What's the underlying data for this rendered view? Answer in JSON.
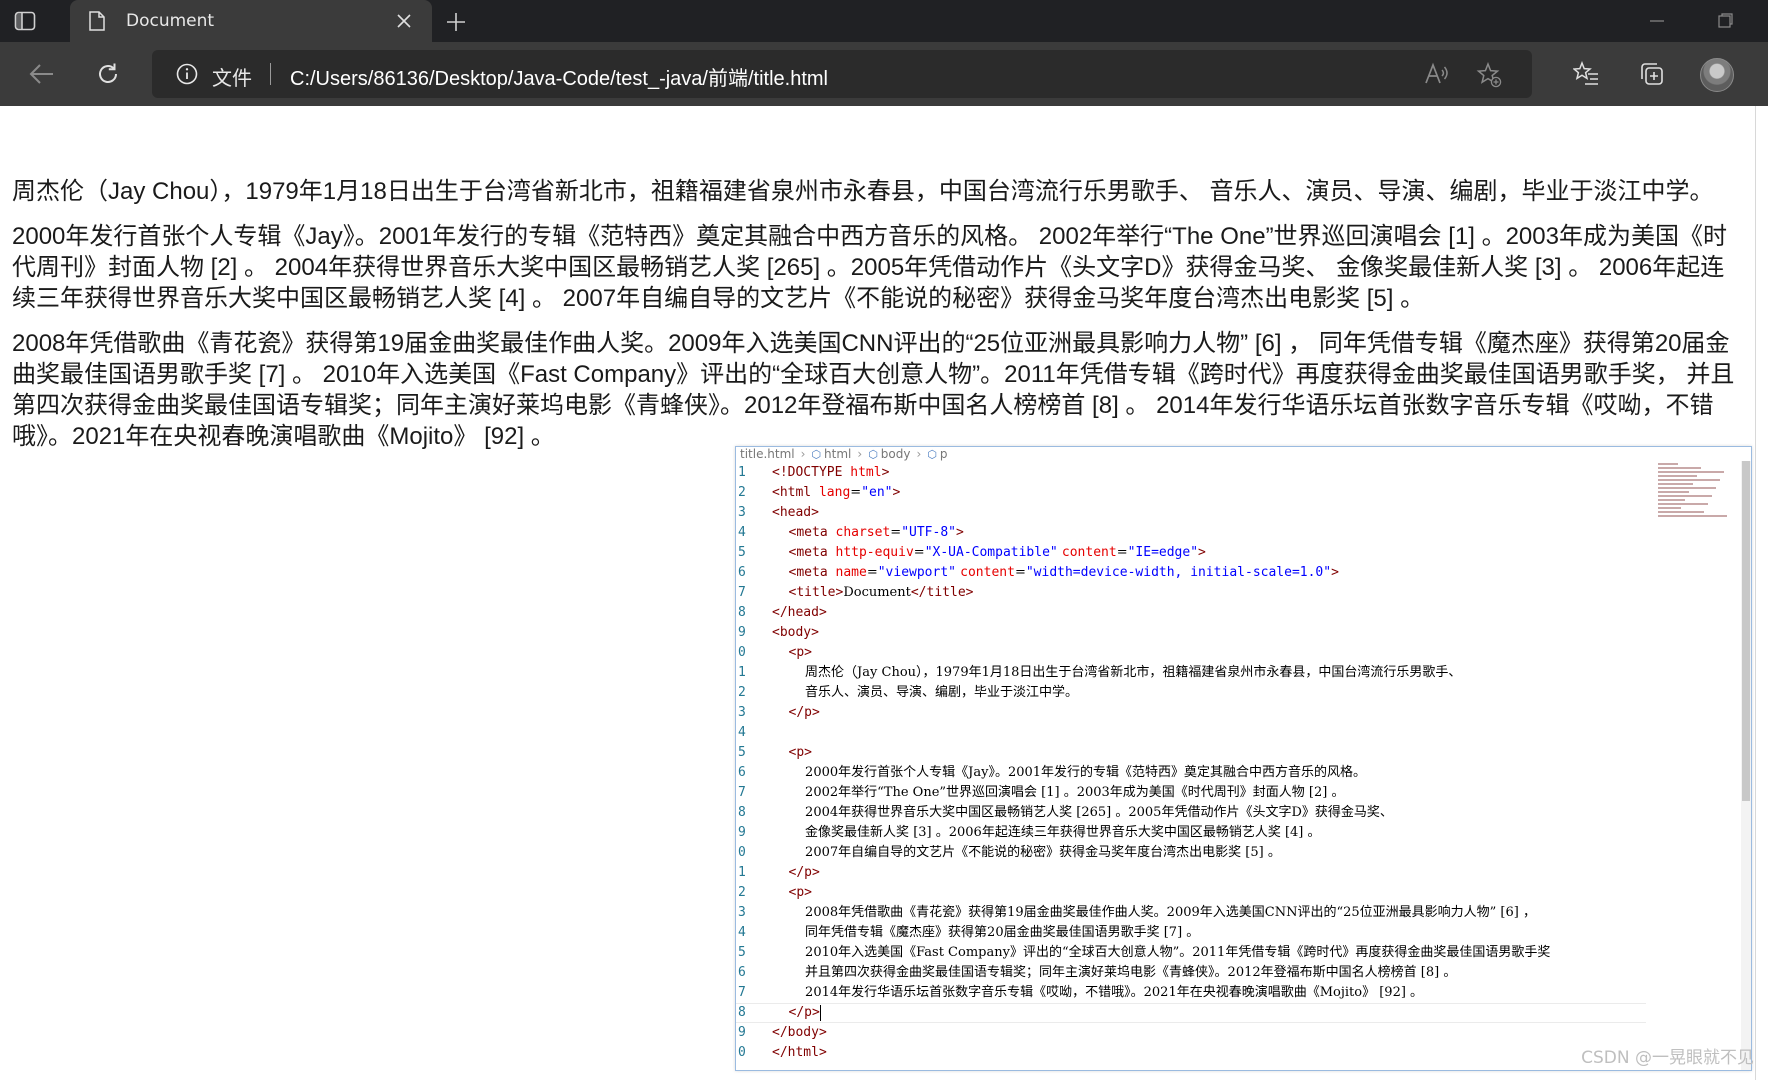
{
  "browser": {
    "tab": {
      "title": "Document",
      "icon": "page-icon"
    },
    "address": {
      "site_label": "文件",
      "url": "C:/Users/86136/Desktop/Java-Code/test_-java/前端/title.html"
    },
    "icons": [
      "sidebar-icon",
      "back-icon",
      "reload-icon",
      "info-icon",
      "read-aloud-icon",
      "add-favorite-icon",
      "favorites-icon",
      "collections-icon",
      "profile-avatar"
    ]
  },
  "page": {
    "paragraphs": [
      "周杰伦（Jay Chou），1979年1月18日出生于台湾省新北市，祖籍福建省泉州市永春县，中国台湾流行乐男歌手、 音乐人、演员、导演、编剧，毕业于淡江中学。",
      "2000年发行首张个人专辑《Jay》。2001年发行的专辑《范特西》奠定其融合中西方音乐的风格。 2002年举行“The One”世界巡回演唱会 [1] 。2003年成为美国《时代周刊》封面人物 [2] 。 2004年获得世界音乐大奖中国区最畅销艺人奖 [265] 。2005年凭借动作片《头文字D》获得金马奖、 金像奖最佳新人奖 [3] 。 2006年起连续三年获得世界音乐大奖中国区最畅销艺人奖 [4] 。 2007年自编自导的文艺片《不能说的秘密》获得金马奖年度台湾杰出电影奖 [5] 。",
      "2008年凭借歌曲《青花瓷》获得第19届金曲奖最佳作曲人奖。2009年入选美国CNN评出的“25位亚洲最具影响力人物” [6] ， 同年凭借专辑《魔杰座》获得第20届金曲奖最佳国语男歌手奖 [7] 。 2010年入选美国《Fast Company》评出的“全球百大创意人物”。2011年凭借专辑《跨时代》再度获得金曲奖最佳国语男歌手奖， 并且第四次获得金曲奖最佳国语专辑奖；同年主演好莱坞电影《青蜂侠》。2012年登福布斯中国名人榜榜首 [8] 。 2014年发行华语乐坛首张数字音乐专辑《哎呦，不错哦》。2021年在央视春晚演唱歌曲《Mojito》 [92] 。"
    ]
  },
  "editor": {
    "breadcrumb": [
      "title.html",
      "html",
      "body",
      "p"
    ],
    "lines": [
      {
        "n": "1",
        "segs": [
          [
            "tag",
            "<!DOCTYPE "
          ],
          [
            "attr",
            "html"
          ],
          [
            "tag",
            ">"
          ]
        ]
      },
      {
        "n": "2",
        "segs": [
          [
            "tag",
            "<html "
          ],
          [
            "attr",
            "lang"
          ],
          [
            "txt",
            "="
          ],
          [
            "str",
            "\"en\""
          ],
          [
            "tag",
            ">"
          ]
        ]
      },
      {
        "n": "3",
        "segs": [
          [
            "tag",
            "<head>"
          ]
        ]
      },
      {
        "n": "4",
        "segs": [
          [
            "txt",
            "    "
          ],
          [
            "tag",
            "<meta "
          ],
          [
            "attr",
            "charset"
          ],
          [
            "txt",
            "="
          ],
          [
            "str",
            "\"UTF-8\""
          ],
          [
            "tag",
            ">"
          ]
        ]
      },
      {
        "n": "5",
        "segs": [
          [
            "txt",
            "    "
          ],
          [
            "tag",
            "<meta "
          ],
          [
            "attr",
            "http-equiv"
          ],
          [
            "txt",
            "="
          ],
          [
            "str",
            "\"X-UA-Compatible\""
          ],
          [
            "txt",
            " "
          ],
          [
            "attr",
            "content"
          ],
          [
            "txt",
            "="
          ],
          [
            "str",
            "\"IE=edge\""
          ],
          [
            "tag",
            ">"
          ]
        ]
      },
      {
        "n": "6",
        "segs": [
          [
            "txt",
            "    "
          ],
          [
            "tag",
            "<meta "
          ],
          [
            "attr",
            "name"
          ],
          [
            "txt",
            "="
          ],
          [
            "str",
            "\"viewport\""
          ],
          [
            "txt",
            " "
          ],
          [
            "attr",
            "content"
          ],
          [
            "txt",
            "="
          ],
          [
            "str",
            "\"width=device-width, initial-scale=1.0\""
          ],
          [
            "tag",
            ">"
          ]
        ]
      },
      {
        "n": "7",
        "segs": [
          [
            "txt",
            "    "
          ],
          [
            "tag",
            "<title>"
          ],
          [
            "txt",
            "Document"
          ],
          [
            "tag",
            "</title>"
          ]
        ]
      },
      {
        "n": "8",
        "segs": [
          [
            "tag",
            "</head>"
          ]
        ]
      },
      {
        "n": "9",
        "segs": [
          [
            "tag",
            "<body>"
          ]
        ]
      },
      {
        "n": "0",
        "segs": [
          [
            "txt",
            "    "
          ],
          [
            "tag",
            "<p>"
          ]
        ]
      },
      {
        "n": "1",
        "segs": [
          [
            "txt",
            "        周杰伦（Jay Chou），1979年1月18日出生于台湾省新北市，祖籍福建省泉州市永春县，中国台湾流行乐男歌手、"
          ]
        ]
      },
      {
        "n": "2",
        "segs": [
          [
            "txt",
            "        音乐人、演员、导演、编剧，毕业于淡江中学。"
          ]
        ]
      },
      {
        "n": "3",
        "segs": [
          [
            "txt",
            "    "
          ],
          [
            "tag",
            "</p>"
          ]
        ]
      },
      {
        "n": "4",
        "segs": []
      },
      {
        "n": "5",
        "segs": [
          [
            "txt",
            "    "
          ],
          [
            "tag",
            "<p>"
          ]
        ]
      },
      {
        "n": "6",
        "segs": [
          [
            "txt",
            "        2000年发行首张个人专辑《Jay》。2001年发行的专辑《范特西》奠定其融合中西方音乐的风格。"
          ]
        ]
      },
      {
        "n": "7",
        "segs": [
          [
            "txt",
            "        2002年举行“The One”世界巡回演唱会 [1] 。2003年成为美国《时代周刊》封面人物 [2] 。"
          ]
        ]
      },
      {
        "n": "8",
        "segs": [
          [
            "txt",
            "        2004年获得世界音乐大奖中国区最畅销艺人奖 [265] 。2005年凭借动作片《头文字D》获得金马奖、"
          ]
        ]
      },
      {
        "n": "9",
        "segs": [
          [
            "txt",
            "        金像奖最佳新人奖 [3] 。2006年起连续三年获得世界音乐大奖中国区最畅销艺人奖 [4] 。"
          ]
        ]
      },
      {
        "n": "0",
        "segs": [
          [
            "txt",
            "        2007年自编自导的文艺片《不能说的秘密》获得金马奖年度台湾杰出电影奖 [5] 。"
          ]
        ]
      },
      {
        "n": "1",
        "segs": [
          [
            "txt",
            "    "
          ],
          [
            "tag",
            "</p>"
          ]
        ]
      },
      {
        "n": "2",
        "segs": [
          [
            "txt",
            "    "
          ],
          [
            "tag",
            "<p>"
          ]
        ]
      },
      {
        "n": "3",
        "segs": [
          [
            "txt",
            "        2008年凭借歌曲《青花瓷》获得第19届金曲奖最佳作曲人奖。2009年入选美国CNN评出的“25位亚洲最具影响力人物” [6] ，"
          ]
        ]
      },
      {
        "n": "4",
        "segs": [
          [
            "txt",
            "        同年凭借专辑《魔杰座》获得第20届金曲奖最佳国语男歌手奖 [7] 。"
          ]
        ]
      },
      {
        "n": "5",
        "segs": [
          [
            "txt",
            "        2010年入选美国《Fast Company》评出的“全球百大创意人物”。2011年凭借专辑《跨时代》再度获得金曲奖最佳国语男歌手奖"
          ]
        ]
      },
      {
        "n": "6",
        "segs": [
          [
            "txt",
            "        并且第四次获得金曲奖最佳国语专辑奖；同年主演好莱坞电影《青蜂侠》。2012年登福布斯中国名人榜榜首 [8] 。"
          ]
        ]
      },
      {
        "n": "7",
        "segs": [
          [
            "txt",
            "        2014年发行华语乐坛首张数字音乐专辑《哎呦，不错哦》。2021年在央视春晚演唱歌曲《Mojito》 [92] 。"
          ]
        ]
      },
      {
        "n": "8",
        "segs": [
          [
            "txt",
            "    "
          ],
          [
            "tag",
            "</p>"
          ]
        ],
        "current": true
      },
      {
        "n": "9",
        "segs": [
          [
            "tag",
            "</body>"
          ]
        ]
      },
      {
        "n": "0",
        "segs": [
          [
            "tag",
            "</html>"
          ]
        ]
      }
    ]
  },
  "watermark": "CSDN @一晃眼就不见",
  "colors": {
    "tab_strip": "#202124",
    "toolbar": "#3b3b3b",
    "omnibox": "#2b2b2b",
    "code_tag": "#800000",
    "code_attr": "#e50000",
    "code_string": "#0000ff"
  }
}
